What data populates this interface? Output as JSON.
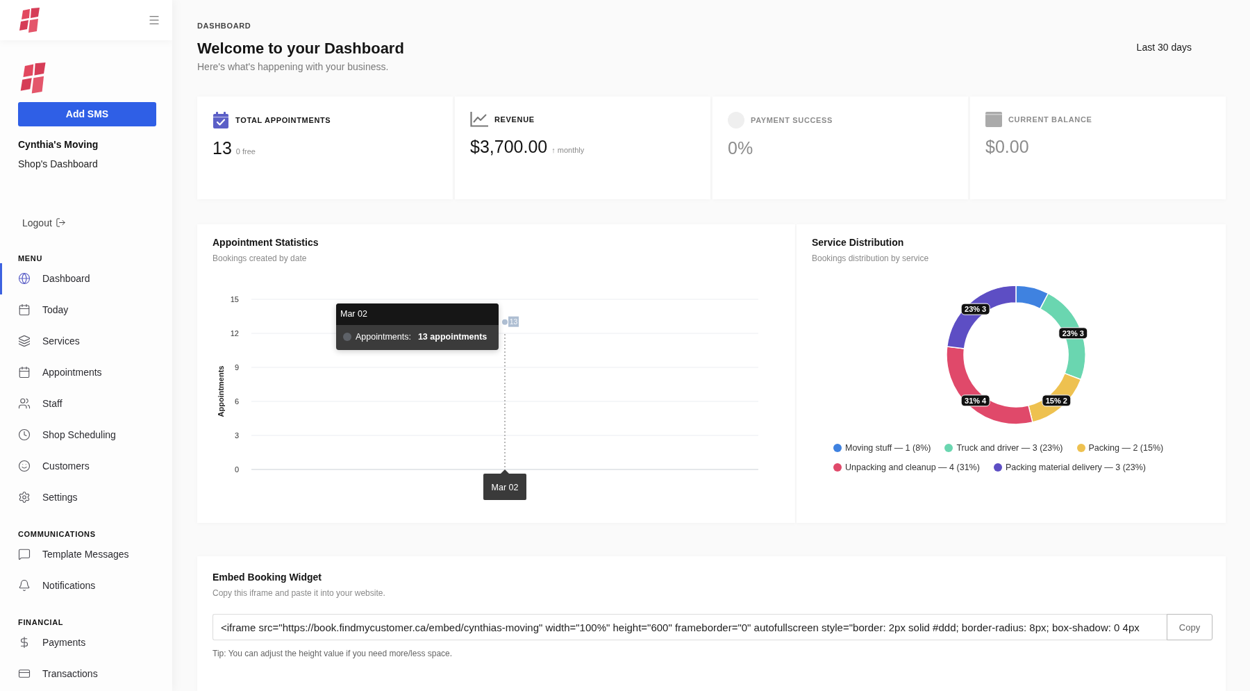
{
  "sidebar": {
    "add_button": "Add SMS",
    "shop_name": "Cynthia's Moving",
    "shop_subtitle": "Shop's Dashboard",
    "logout": "Logout",
    "sections": [
      {
        "title": "MENU",
        "items": [
          {
            "label": "Dashboard",
            "selected": true
          },
          {
            "label": "Today",
            "selected": false
          },
          {
            "label": "Services",
            "selected": false
          },
          {
            "label": "Appointments",
            "selected": false
          },
          {
            "label": "Staff",
            "selected": false
          },
          {
            "label": "Shop Scheduling",
            "selected": false
          },
          {
            "label": "Customers",
            "selected": false
          },
          {
            "label": "Settings",
            "selected": false
          }
        ]
      },
      {
        "title": "COMMUNICATIONS",
        "items": [
          {
            "label": "Template Messages",
            "selected": false
          },
          {
            "label": "Notifications",
            "selected": false
          }
        ]
      },
      {
        "title": "FINANCIAL",
        "items": [
          {
            "label": "Payments",
            "selected": false
          },
          {
            "label": "Transactions",
            "selected": false
          }
        ]
      }
    ]
  },
  "header": {
    "breadcrumb": "DASHBOARD",
    "title": "Welcome to your Dashboard",
    "subtitle": "Here's what's happening with your business.",
    "date_range": "Last 30 days"
  },
  "stat_cards": [
    {
      "kind": "appointments",
      "label": "TOTAL APPOINTMENTS",
      "value": "13",
      "note": "0 free",
      "dimmed": false
    },
    {
      "kind": "revenue",
      "label": "REVENUE",
      "value": "$3,700.00",
      "note": "↑ monthly",
      "dimmed": false
    },
    {
      "kind": "payment",
      "label": "PAYMENT SUCCESS",
      "value": "0%",
      "dimmed": true
    },
    {
      "kind": "balance",
      "label": "CURRENT BALANCE",
      "value": "$0.00",
      "dimmed": true
    }
  ],
  "appointment_statistics": {
    "title": "Appointment Statistics",
    "subtitle": "Bookings created by date",
    "chart_data": {
      "type": "line",
      "ylabel": "Appointments",
      "x": [
        "Mar 02"
      ],
      "series": [
        {
          "color": "#aebed2",
          "marker": "circle",
          "values": [
            13
          ]
        }
      ],
      "ylim": [
        0,
        15
      ],
      "yticks": [
        0,
        3,
        6,
        9,
        12,
        15
      ],
      "grid": true,
      "data_labels": true,
      "ref_lines": [
        {
          "axis": "x",
          "value": "Mar 02"
        }
      ]
    },
    "tooltip": {
      "title": "Mar 02",
      "label": "Appointments:",
      "value": "13 appointments"
    }
  },
  "service_distribution": {
    "title": "Service Distribution",
    "subtitle": "Bookings distribution by service",
    "chart_data": {
      "type": "donut",
      "values": [
        1,
        3,
        2,
        4,
        3
      ],
      "value_labels": [
        null,
        "23% 3",
        "15% 2",
        "31% 4",
        "23% 3"
      ]
    },
    "legend": [
      {
        "label": "Moving stuff — 1 (8%)",
        "color": "#3f82e0"
      },
      {
        "label": "Truck and driver — 3 (23%)",
        "color": "#6ad6b0"
      },
      {
        "label": "Packing — 2 (15%)",
        "color": "#eec150"
      },
      {
        "label": "Unpacking and cleanup — 4 (31%)",
        "color": "#e0496a"
      },
      {
        "label": "Packing material delivery — 3 (23%)",
        "color": "#5d4ec4"
      }
    ]
  },
  "embed": {
    "title": "Embed Booking Widget",
    "subtitle": "Copy this iframe and paste it into your website.",
    "code": "<iframe src=\"https://book.findmycustomer.ca/embed/cynthias-moving\" width=\"100%\" height=\"600\" frameborder=\"0\" autofullscreen style=\"border: 2px solid #ddd; border-radius: 8px; box-shadow: 0 4px",
    "copy_button": "Copy",
    "tip": "Tip: You can adjust the height value if you need more/less space."
  }
}
